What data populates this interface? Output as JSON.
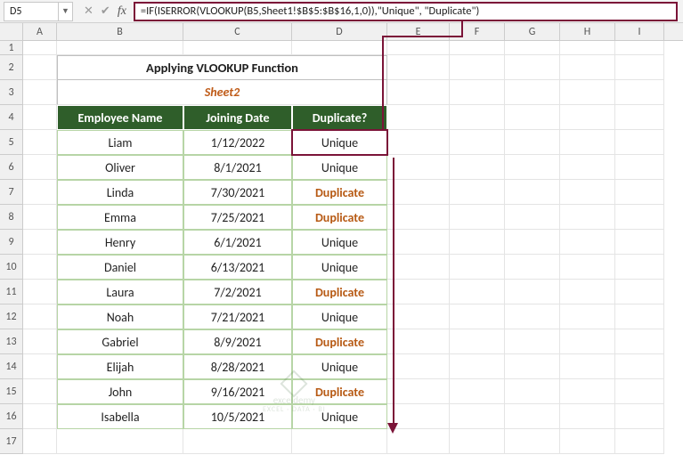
{
  "namebox": "D5",
  "formula": "=IF(ISERROR(VLOOKUP(B5,Sheet1!$B$5:$B$16,1,0)),\"Unique\", \"Duplicate\")",
  "cols": [
    "A",
    "B",
    "C",
    "D",
    "E",
    "F",
    "G",
    "H",
    "I"
  ],
  "rows": [
    "1",
    "2",
    "3",
    "4",
    "5",
    "6",
    "7",
    "8",
    "9",
    "10",
    "11",
    "12",
    "13",
    "14",
    "15",
    "16",
    "17"
  ],
  "title": "Applying VLOOKUP Function",
  "sheet_label": "Sheet2",
  "headers": {
    "name": "Employee Name",
    "date": "Joining Date",
    "dup": "Duplicate?"
  },
  "data": [
    {
      "name": "Liam",
      "date": "1/12/2022",
      "dup": "Unique",
      "is_dup": false
    },
    {
      "name": "Oliver",
      "date": "8/1/2021",
      "dup": "Unique",
      "is_dup": false
    },
    {
      "name": "Linda",
      "date": "7/30/2021",
      "dup": "Duplicate",
      "is_dup": true
    },
    {
      "name": "Emma",
      "date": "7/25/2021",
      "dup": "Duplicate",
      "is_dup": true
    },
    {
      "name": "Henry",
      "date": "6/1/2021",
      "dup": "Unique",
      "is_dup": false
    },
    {
      "name": "Daniel",
      "date": "6/13/2021",
      "dup": "Unique",
      "is_dup": false
    },
    {
      "name": "Laura",
      "date": "7/2/2021",
      "dup": "Duplicate",
      "is_dup": true
    },
    {
      "name": "Noah",
      "date": "7/21/2021",
      "dup": "Unique",
      "is_dup": false
    },
    {
      "name": "Gabriel",
      "date": "8/9/2021",
      "dup": "Duplicate",
      "is_dup": true
    },
    {
      "name": "Elijah",
      "date": "8/28/2021",
      "dup": "Unique",
      "is_dup": false
    },
    {
      "name": "John",
      "date": "9/16/2021",
      "dup": "Duplicate",
      "is_dup": true
    },
    {
      "name": "Isabella",
      "date": "10/5/2021",
      "dup": "Unique",
      "is_dup": false
    }
  ],
  "watermark": {
    "brand": "exceldemy",
    "sub": "EXCEL · DATA · BI"
  }
}
